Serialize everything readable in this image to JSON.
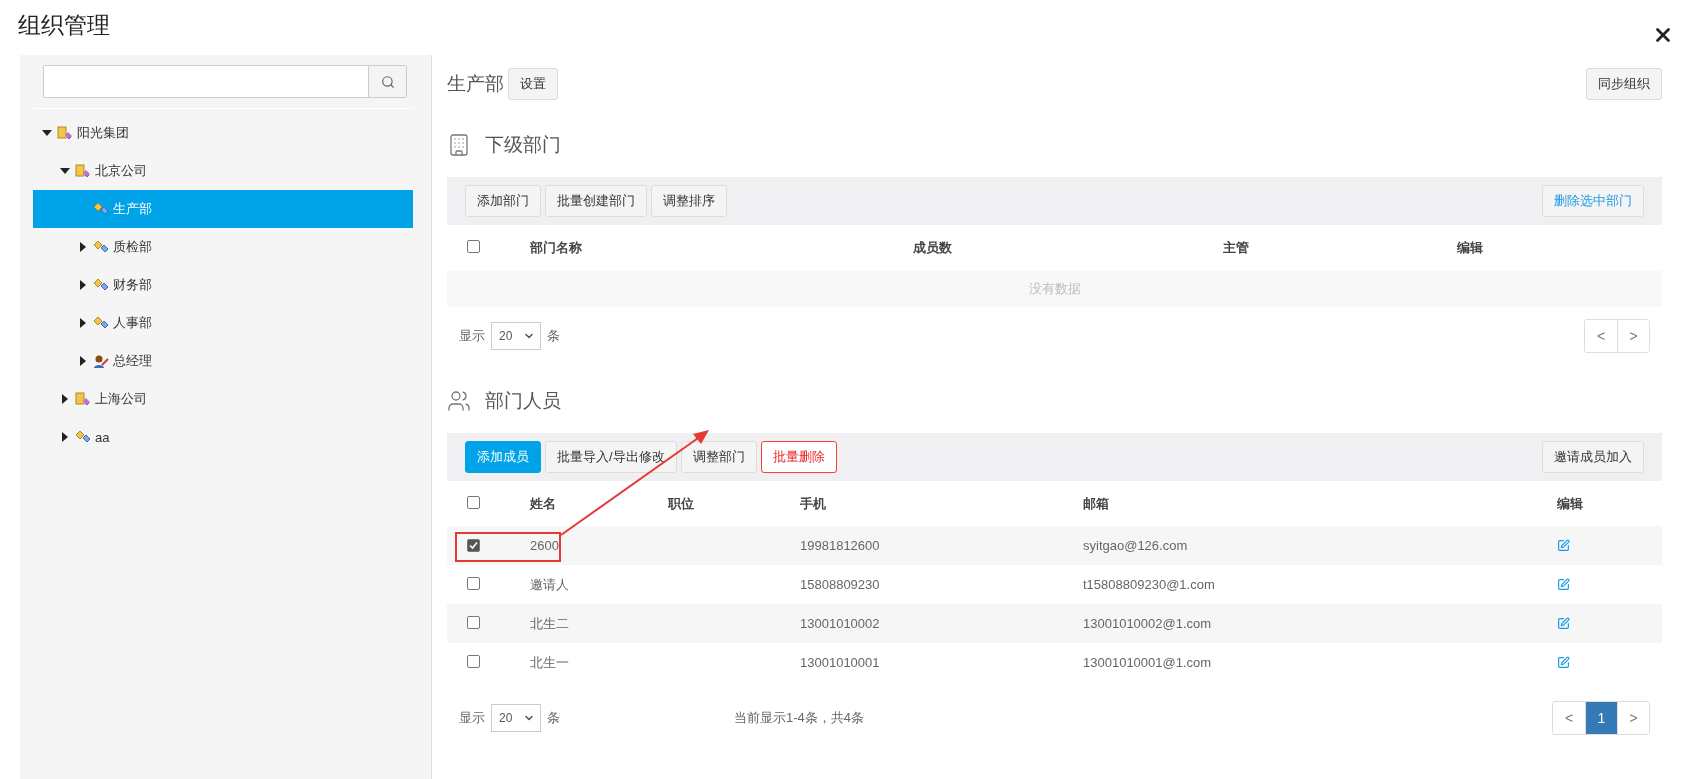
{
  "window": {
    "title": "组织管理"
  },
  "sidebar": {
    "tree": [
      {
        "label": "阳光集团",
        "kind": "company",
        "expanded": true,
        "selected": false,
        "children": [
          {
            "label": "北京公司",
            "kind": "company",
            "expanded": true,
            "selected": false,
            "children": [
              {
                "label": "生产部",
                "kind": "department",
                "has_children": false,
                "selected": true
              },
              {
                "label": "质检部",
                "kind": "department",
                "expanded": false,
                "has_children": true,
                "selected": false
              },
              {
                "label": "财务部",
                "kind": "department",
                "expanded": false,
                "has_children": true,
                "selected": false
              },
              {
                "label": "人事部",
                "kind": "department",
                "expanded": false,
                "has_children": true,
                "selected": false
              },
              {
                "label": "总经理",
                "kind": "person",
                "expanded": false,
                "has_children": true,
                "selected": false
              }
            ]
          },
          {
            "label": "上海公司",
            "kind": "company",
            "expanded": false,
            "has_children": true,
            "selected": false
          },
          {
            "label": "aa",
            "kind": "department",
            "expanded": false,
            "has_children": true,
            "selected": false
          }
        ]
      }
    ]
  },
  "header": {
    "title": "生产部",
    "settings_button": "设置",
    "sync_button": "同步组织"
  },
  "sub_departments": {
    "heading": "下级部门",
    "toolbar": [
      {
        "label": "添加部门",
        "kind": "default"
      },
      {
        "label": "批量创建部门",
        "kind": "default"
      },
      {
        "label": "调整排序",
        "kind": "default"
      }
    ],
    "toolbar_right": {
      "label": "删除选中部门",
      "kind": "link"
    },
    "columns": [
      "部门名称",
      "成员数",
      "主管",
      "编辑"
    ],
    "select_all": {
      "checked": false
    },
    "empty_text": "没有数据",
    "footer": {
      "show_label": "显示",
      "page_size": "20",
      "unit": "条"
    },
    "pagination": [
      {
        "label": "<",
        "selected": false
      },
      {
        "label": ">",
        "selected": false
      }
    ]
  },
  "members": {
    "heading": "部门人员",
    "toolbar": [
      {
        "label": "添加成员",
        "kind": "primary"
      },
      {
        "label": "批量导入/导出修改",
        "kind": "default"
      },
      {
        "label": "调整部门",
        "kind": "default"
      },
      {
        "label": "批量删除",
        "kind": "danger"
      }
    ],
    "toolbar_right": {
      "label": "邀请成员加入",
      "kind": "default"
    },
    "columns": [
      "姓名",
      "职位",
      "手机",
      "邮箱",
      "编辑"
    ],
    "select_all": {
      "checked": false
    },
    "rows": [
      {
        "checked": true,
        "highlighted": true,
        "name": "2600",
        "phone": "19981812600",
        "email": "syitgao@126.com"
      },
      {
        "checked": false,
        "highlighted": false,
        "name": "邀请人",
        "phone": "15808809230",
        "email": "t15808809230@1.com"
      },
      {
        "checked": false,
        "highlighted": false,
        "name": "北生二",
        "phone": "13001010002",
        "email": "13001010002@1.com"
      },
      {
        "checked": false,
        "highlighted": false,
        "name": "北生一",
        "phone": "13001010001",
        "email": "13001010001@1.com"
      }
    ],
    "footer": {
      "show_label": "显示",
      "page_size": "20",
      "unit": "条",
      "summary": "当前显示1-4条，共4条"
    },
    "pagination": [
      {
        "label": "<",
        "selected": false
      },
      {
        "label": "1",
        "selected": true
      },
      {
        "label": ">",
        "selected": false
      }
    ]
  }
}
